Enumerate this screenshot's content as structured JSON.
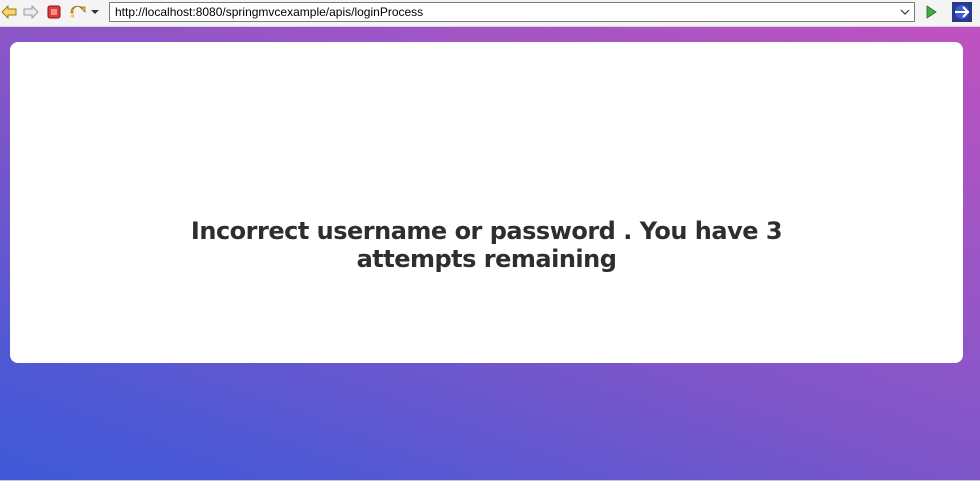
{
  "browser": {
    "url": "http://localhost:8080/springmvcexample/apis/loginProcess",
    "icons": [
      "back-arrow-icon",
      "forward-arrow-icon",
      "stop-icon",
      "refresh-icon",
      "dropdown-arrow-icon",
      "go-icon",
      "eclipse-icon"
    ]
  },
  "page": {
    "message": "Incorrect username or password . You have 3 attempts remaining"
  }
}
